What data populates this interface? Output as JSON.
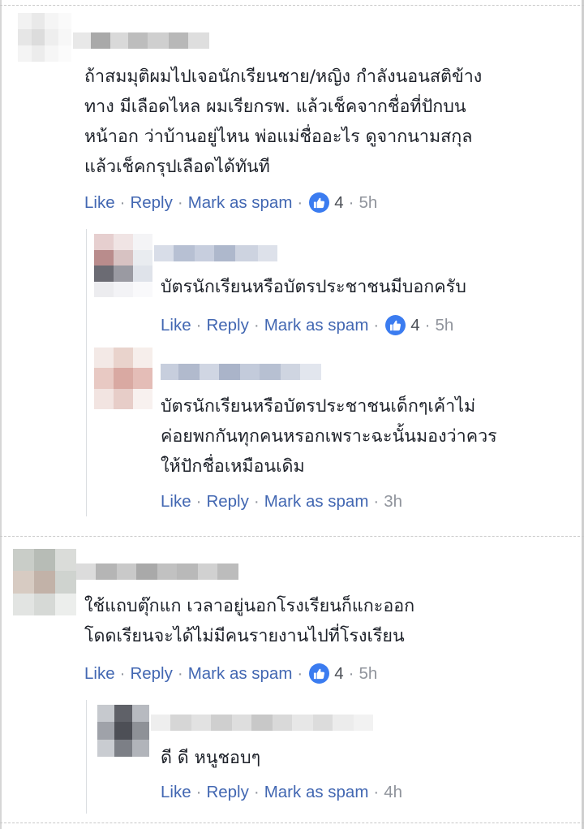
{
  "actions": {
    "like": "Like",
    "reply": "Reply",
    "spam": "Mark as spam",
    "separator": "·"
  },
  "comments": [
    {
      "text": "ถ้าสมมุติผมไปเจอนักเรียนชาย/หญิง กำลังนอนสติข้าง\nทาง มีเลือดไหล ผมเรียกรพ. แล้วเช็คจากชื่อที่ปักบน\nหน้าอก ว่าบ้านอยู่ไหน พ่อแม่ชื่ออะไร ดูจากนามสกุล\nแล้วเช็คกรุปเลือดได้ทันที",
      "reactions": "4",
      "time": "5h"
    },
    {
      "text": "บัตรนักเรียนหรือบัตรประชาชนมีบอกครับ",
      "reactions": "4",
      "time": "5h"
    },
    {
      "text": "บัตรนักเรียนหรือบัตรประชาชนเด็กๆเค้าไม่\nค่อยพกกันทุกคนหรอกเพราะฉะนั้นมองว่าควร\nให้ปักชื่อเหมือนเดิม",
      "time": "3h"
    },
    {
      "text": "ใช้แถบตุ๊กแก เวลาอยู่นอกโรงเรียนก็แกะออก\nโดดเรียนจะได้ไม่มีคนรายงานไปที่โรงเรียน",
      "reactions": "4",
      "time": "5h"
    },
    {
      "text": "ดี ดี หนูชอบๆ",
      "time": "4h"
    }
  ],
  "colors": {
    "link": "#4267b2",
    "meta": "#90949c",
    "reaction_icon": "#3b7cf0"
  },
  "icons": {
    "reaction": "thumbs-up-icon"
  }
}
